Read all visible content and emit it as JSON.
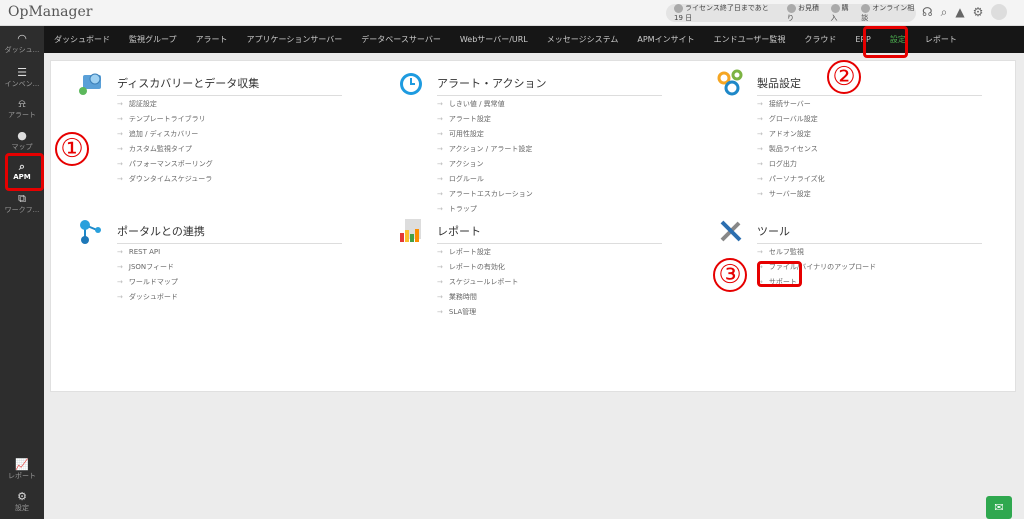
{
  "app": {
    "title": "OpManager"
  },
  "header": {
    "license": "ライセンス終了日まであと 19 日",
    "quote": "お見積り",
    "buy": "購入",
    "consult": "オンライン相談"
  },
  "sidebar": [
    {
      "label": "ダッシュ...",
      "icon": "dashboard-icon"
    },
    {
      "label": "インベン...",
      "icon": "inventory-icon"
    },
    {
      "label": "アラート",
      "icon": "alarm-icon"
    },
    {
      "label": "マップ",
      "icon": "map-pin-icon"
    },
    {
      "label": "APM",
      "icon": "apm-icon"
    },
    {
      "label": "ワークフ...",
      "icon": "workflow-icon"
    },
    {
      "label": "レポート",
      "icon": "report-icon"
    },
    {
      "label": "設定",
      "icon": "gear-icon"
    }
  ],
  "nav": [
    "ダッシュボード",
    "監視グループ",
    "アラート",
    "アプリケーションサーバー",
    "データベースサーバー",
    "Webサーバー/URL",
    "メッセージシステム",
    "APMインサイト",
    "エンドユーザー監視",
    "クラウド",
    "ERP",
    "設定",
    "レポート"
  ],
  "sections": [
    {
      "title": "ディスカバリーとデータ収集",
      "items": [
        "認証設定",
        "テンプレートライブラリ",
        "追加 / ディスカバリー",
        "カスタム監視タイプ",
        "パフォーマンスポーリング",
        "ダウンタイムスケジューラ"
      ]
    },
    {
      "title": "アラート・アクション",
      "items": [
        "しきい値 / 異常値",
        "アラート設定",
        "可用性設定",
        "アクション / アラート設定",
        "アクション",
        "ログルール",
        "アラートエスカレーション",
        "トラップ"
      ]
    },
    {
      "title": "製品設定",
      "items": [
        "接続サーバー",
        "グローバル設定",
        "アドオン設定",
        "製品ライセンス",
        "ログ出力",
        "パーソナライズ化",
        "サーバー設定"
      ]
    },
    {
      "title": "ポータルとの連携",
      "items": [
        "REST API",
        "JSONフィード",
        "ワールドマップ",
        "ダッシュボード"
      ]
    },
    {
      "title": "レポート",
      "items": [
        "レポート設定",
        "レポートの有効化",
        "スケジュールレポート",
        "業務時間",
        "SLA管理"
      ]
    },
    {
      "title": "ツール",
      "items": [
        "セルフ監視",
        "ファイル/バイナリのアップロード",
        "サポート"
      ]
    }
  ],
  "annotations": [
    "①",
    "②",
    "③"
  ],
  "colors": {
    "accent": "#4caf50",
    "highlight": "#e60000"
  }
}
